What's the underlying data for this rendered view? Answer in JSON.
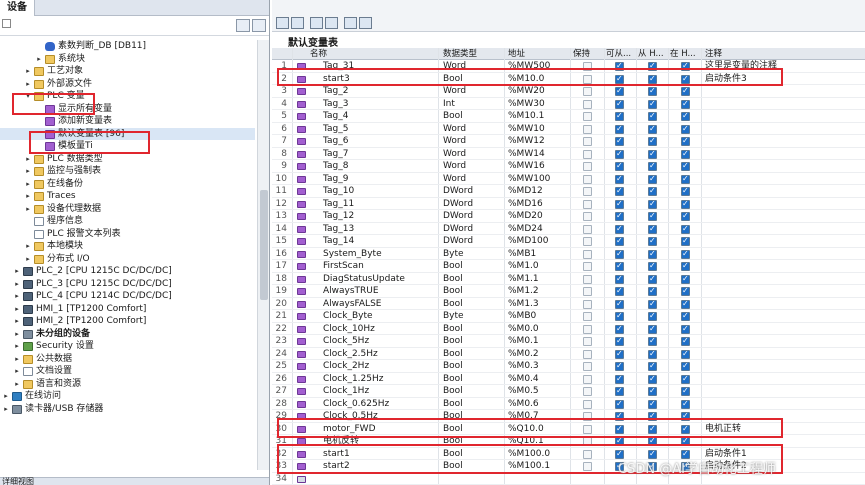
{
  "left_panel": {
    "title": "设备",
    "footer": "详细视图",
    "tree": [
      {
        "label": "素数判断_DB [DB11]",
        "indent": 3,
        "icon": "db-icon"
      },
      {
        "label": "系统块",
        "indent": 3,
        "arrow": "▸",
        "icon": "folder-icon"
      },
      {
        "label": "工艺对象",
        "indent": 2,
        "arrow": "▸",
        "icon": "folder-icon"
      },
      {
        "label": "外部源文件",
        "indent": 2,
        "arrow": "▸",
        "icon": "folder-icon"
      },
      {
        "label": "PLC 变量",
        "indent": 2,
        "arrow": "▾",
        "icon": "folder-icon"
      },
      {
        "label": "显示所有变量",
        "indent": 3,
        "icon": "tag-icon"
      },
      {
        "label": "添加新变量表",
        "indent": 3,
        "icon": "tag-icon"
      },
      {
        "label": "默认变量表 [96]",
        "indent": 3,
        "icon": "tag-icon",
        "selected": true
      },
      {
        "label": "模板量Ti",
        "indent": 3,
        "icon": "tag-icon"
      },
      {
        "label": "PLC 数据类型",
        "indent": 2,
        "arrow": "▸",
        "icon": "folder-icon"
      },
      {
        "label": "监控与强制表",
        "indent": 2,
        "arrow": "▸",
        "icon": "folder-icon"
      },
      {
        "label": "在线备份",
        "indent": 2,
        "arrow": "▸",
        "icon": "folder-icon"
      },
      {
        "label": "Traces",
        "indent": 2,
        "arrow": "▸",
        "icon": "folder-icon"
      },
      {
        "label": "设备代理数据",
        "indent": 2,
        "arrow": "▸",
        "icon": "folder-icon"
      },
      {
        "label": "程序信息",
        "indent": 2,
        "icon": "doc-icon"
      },
      {
        "label": "PLC 报警文本列表",
        "indent": 2,
        "icon": "doc-icon"
      },
      {
        "label": "本地模块",
        "indent": 2,
        "arrow": "▸",
        "icon": "folder-icon"
      },
      {
        "label": "分布式 I/O",
        "indent": 2,
        "arrow": "▸",
        "icon": "folder-icon"
      },
      {
        "label": "PLC_2 [CPU 1215C DC/DC/DC]",
        "indent": 1,
        "arrow": "▸",
        "icon": "plc-icon"
      },
      {
        "label": "PLC_3 [CPU 1215C DC/DC/DC]",
        "indent": 1,
        "arrow": "▸",
        "icon": "plc-icon"
      },
      {
        "label": "PLC_4 [CPU 1214C DC/DC/DC]",
        "indent": 1,
        "arrow": "▸",
        "icon": "plc-icon"
      },
      {
        "label": "HMI_1 [TP1200 Comfort]",
        "indent": 1,
        "arrow": "▸",
        "icon": "plc-icon"
      },
      {
        "label": "HMI_2 [TP1200 Comfort]",
        "indent": 1,
        "arrow": "▸",
        "icon": "plc-icon"
      },
      {
        "label": "未分组的设备",
        "indent": 1,
        "arrow": "▸",
        "icon": "dev-icon",
        "bold": true
      },
      {
        "label": "Security 设置",
        "indent": 1,
        "arrow": "▸",
        "icon": "green-icon"
      },
      {
        "label": "公共数据",
        "indent": 1,
        "arrow": "▸",
        "icon": "folder-icon"
      },
      {
        "label": "文档设置",
        "indent": 1,
        "arrow": "▸",
        "icon": "doc-icon"
      },
      {
        "label": "语言和资源",
        "indent": 1,
        "arrow": "▸",
        "icon": "folder-icon"
      },
      {
        "label": "在线访问",
        "indent": 0,
        "arrow": "▸",
        "icon": "net-icon"
      },
      {
        "label": "读卡器/USB 存储器",
        "indent": 0,
        "arrow": "▸",
        "icon": "dev-icon"
      }
    ]
  },
  "right_panel": {
    "title": "默认变量表",
    "columns": {
      "name": "名称",
      "datatype": "数据类型",
      "address": "地址",
      "retain": "保持",
      "accessible": "可从...",
      "writable": "从 H...",
      "visible": "在 H...",
      "comment": "注释"
    },
    "rows": [
      {
        "num": "1",
        "name": "Tag_31",
        "dtype": "Word",
        "addr": "%MW500",
        "comment": "这里是变量的注释"
      },
      {
        "num": "2",
        "name": "start3",
        "dtype": "Bool",
        "addr": "%M10.0",
        "comment": "启动条件3"
      },
      {
        "num": "3",
        "name": "Tag_2",
        "dtype": "Word",
        "addr": "%MW20",
        "comment": ""
      },
      {
        "num": "4",
        "name": "Tag_3",
        "dtype": "Int",
        "addr": "%MW30",
        "comment": ""
      },
      {
        "num": "5",
        "name": "Tag_4",
        "dtype": "Bool",
        "addr": "%M10.1",
        "comment": ""
      },
      {
        "num": "6",
        "name": "Tag_5",
        "dtype": "Word",
        "addr": "%MW10",
        "comment": ""
      },
      {
        "num": "7",
        "name": "Tag_6",
        "dtype": "Word",
        "addr": "%MW12",
        "comment": ""
      },
      {
        "num": "8",
        "name": "Tag_7",
        "dtype": "Word",
        "addr": "%MW14",
        "comment": ""
      },
      {
        "num": "9",
        "name": "Tag_8",
        "dtype": "Word",
        "addr": "%MW16",
        "comment": ""
      },
      {
        "num": "10",
        "name": "Tag_9",
        "dtype": "Word",
        "addr": "%MW100",
        "comment": ""
      },
      {
        "num": "11",
        "name": "Tag_10",
        "dtype": "DWord",
        "addr": "%MD12",
        "comment": ""
      },
      {
        "num": "12",
        "name": "Tag_11",
        "dtype": "DWord",
        "addr": "%MD16",
        "comment": ""
      },
      {
        "num": "13",
        "name": "Tag_12",
        "dtype": "DWord",
        "addr": "%MD20",
        "comment": ""
      },
      {
        "num": "14",
        "name": "Tag_13",
        "dtype": "DWord",
        "addr": "%MD24",
        "comment": ""
      },
      {
        "num": "15",
        "name": "Tag_14",
        "dtype": "DWord",
        "addr": "%MD100",
        "comment": ""
      },
      {
        "num": "16",
        "name": "System_Byte",
        "dtype": "Byte",
        "addr": "%MB1",
        "comment": ""
      },
      {
        "num": "17",
        "name": "FirstScan",
        "dtype": "Bool",
        "addr": "%M1.0",
        "comment": ""
      },
      {
        "num": "18",
        "name": "DiagStatusUpdate",
        "dtype": "Bool",
        "addr": "%M1.1",
        "comment": ""
      },
      {
        "num": "19",
        "name": "AlwaysTRUE",
        "dtype": "Bool",
        "addr": "%M1.2",
        "comment": ""
      },
      {
        "num": "20",
        "name": "AlwaysFALSE",
        "dtype": "Bool",
        "addr": "%M1.3",
        "comment": ""
      },
      {
        "num": "21",
        "name": "Clock_Byte",
        "dtype": "Byte",
        "addr": "%MB0",
        "comment": ""
      },
      {
        "num": "22",
        "name": "Clock_10Hz",
        "dtype": "Bool",
        "addr": "%M0.0",
        "comment": ""
      },
      {
        "num": "23",
        "name": "Clock_5Hz",
        "dtype": "Bool",
        "addr": "%M0.1",
        "comment": ""
      },
      {
        "num": "24",
        "name": "Clock_2.5Hz",
        "dtype": "Bool",
        "addr": "%M0.2",
        "comment": ""
      },
      {
        "num": "25",
        "name": "Clock_2Hz",
        "dtype": "Bool",
        "addr": "%M0.3",
        "comment": ""
      },
      {
        "num": "26",
        "name": "Clock_1.25Hz",
        "dtype": "Bool",
        "addr": "%M0.4",
        "comment": ""
      },
      {
        "num": "27",
        "name": "Clock_1Hz",
        "dtype": "Bool",
        "addr": "%M0.5",
        "comment": ""
      },
      {
        "num": "28",
        "name": "Clock_0.625Hz",
        "dtype": "Bool",
        "addr": "%M0.6",
        "comment": ""
      },
      {
        "num": "29",
        "name": "Clock_0.5Hz",
        "dtype": "Bool",
        "addr": "%M0.7",
        "comment": ""
      },
      {
        "num": "30",
        "name": "motor_FWD",
        "dtype": "Bool",
        "addr": "%Q10.0",
        "comment": "电机正转"
      },
      {
        "num": "31",
        "name": "电机反转",
        "dtype": "Bool",
        "addr": "%Q10.1",
        "comment": ""
      },
      {
        "num": "32",
        "name": "start1",
        "dtype": "Bool",
        "addr": "%M100.0",
        "comment": "启动条件1"
      },
      {
        "num": "33",
        "name": "start2",
        "dtype": "Bool",
        "addr": "%M100.1",
        "comment": "启动条件2"
      },
      {
        "num": "34",
        "name": "",
        "dtype": "",
        "addr": "",
        "comment": ""
      }
    ]
  },
  "watermark": "CSDN @AI学自动化工程师",
  "colors": {
    "highlight": "#e0262e",
    "checkbox_on": "#1f6fc7",
    "header": "#e4e8ee"
  }
}
